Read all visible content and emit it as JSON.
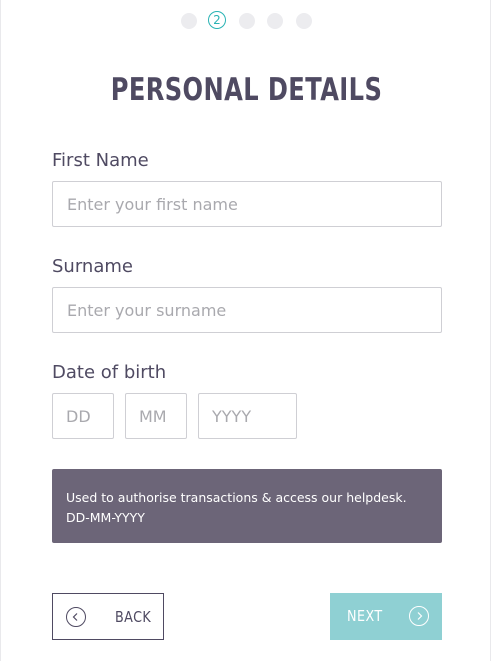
{
  "steps": {
    "current_label": "2",
    "total": 5
  },
  "form": {
    "title": "PERSONAL DETAILS",
    "first_name": {
      "label": "First Name",
      "placeholder": "Enter your first name",
      "value": ""
    },
    "surname": {
      "label": "Surname",
      "placeholder": "Enter your surname",
      "value": ""
    },
    "dob": {
      "label": "Date of birth",
      "day_placeholder": "DD",
      "month_placeholder": "MM",
      "year_placeholder": "YYYY"
    },
    "info_line1": "Used to authorise transactions & access our helpdesk.",
    "info_line2": "DD-MM-YYYY"
  },
  "buttons": {
    "back_label": "BACK",
    "next_label": "NEXT"
  },
  "colors": {
    "accent": "#2ab3b4",
    "text": "#4f4a62",
    "info_bg": "#6c6578",
    "next_bg": "#8fd0d3"
  },
  "icons": {
    "back": "chevron-left-circle-icon",
    "next": "chevron-right-circle-icon"
  }
}
